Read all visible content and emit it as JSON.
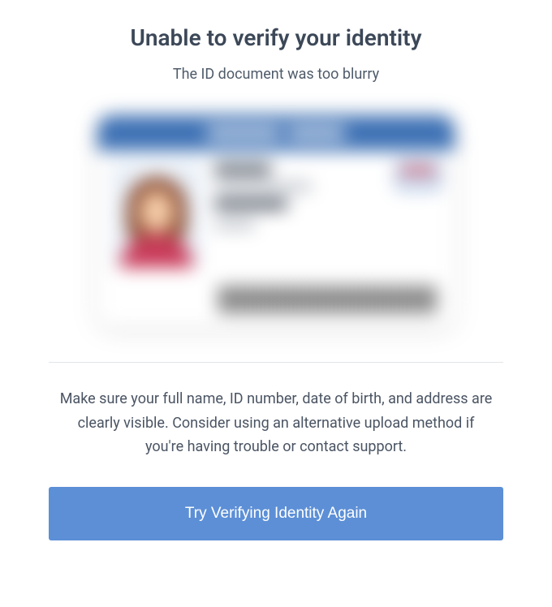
{
  "heading": "Unable to verify your identity",
  "subheading": "The ID document was too blurry",
  "instructions": "Make sure your full name, ID number, date of birth, and address are clearly visible. Consider using an alternative upload method if you're having trouble or contact support.",
  "action_button_label": "Try Verifying Identity Again",
  "colors": {
    "primary_button": "#5c8fd6",
    "heading_text": "#3c4858",
    "body_text": "#4a5463"
  }
}
